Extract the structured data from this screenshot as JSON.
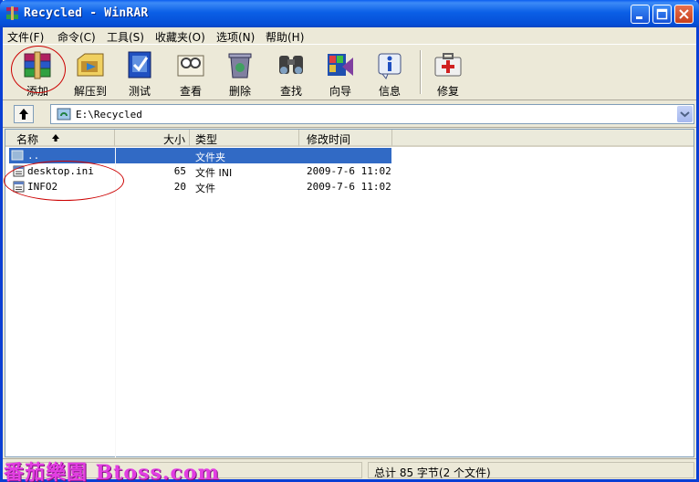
{
  "window": {
    "title": "Recycled - WinRAR"
  },
  "menu": [
    "文件(F)",
    "命令(C)",
    "工具(S)",
    "收藏夹(O)",
    "选项(N)",
    "帮助(H)"
  ],
  "toolbar": [
    {
      "label": "添加",
      "icon": "add-archive-icon"
    },
    {
      "label": "解压到",
      "icon": "extract-to-icon"
    },
    {
      "label": "测试",
      "icon": "test-icon"
    },
    {
      "label": "查看",
      "icon": "view-icon"
    },
    {
      "label": "删除",
      "icon": "delete-icon"
    },
    {
      "label": "查找",
      "icon": "find-icon"
    },
    {
      "label": "向导",
      "icon": "wizard-icon"
    },
    {
      "label": "信息",
      "icon": "info-icon"
    },
    {
      "label": "修复",
      "icon": "repair-icon"
    }
  ],
  "address": {
    "path": "E:\\Recycled"
  },
  "columns": {
    "name": "名称",
    "size": "大小",
    "type": "类型",
    "modified": "修改时间"
  },
  "files": [
    {
      "name": "..",
      "size": "",
      "type": "文件夹",
      "modified": ""
    },
    {
      "name": "desktop.ini",
      "size": "65",
      "type": "文件 INI",
      "modified": "2009-7-6 11:02"
    },
    {
      "name": "INFO2",
      "size": "20",
      "type": "文件",
      "modified": "2009-7-6 11:02"
    }
  ],
  "status": {
    "summary": "总计 85 字节(2 个文件)"
  },
  "watermark": "番茄樂園 Btoss.com"
}
